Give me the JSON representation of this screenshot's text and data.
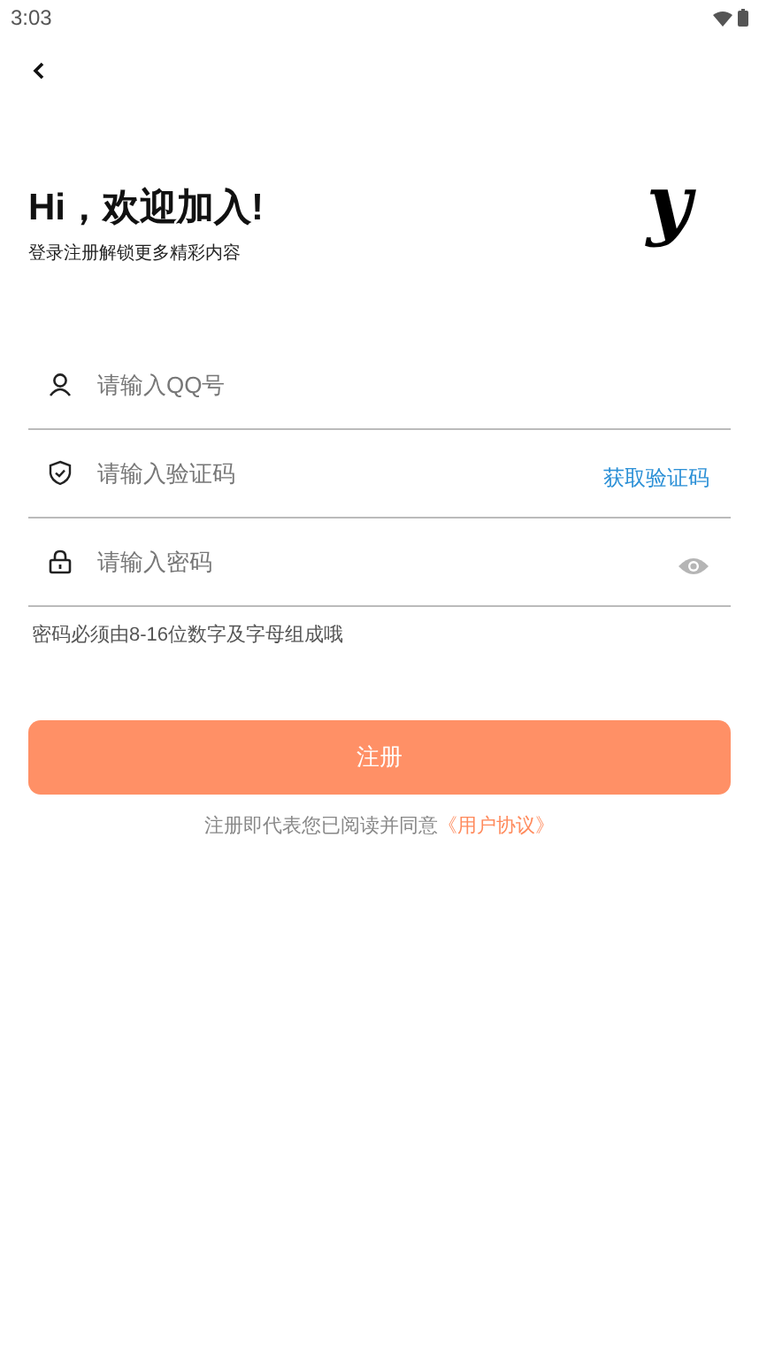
{
  "status_bar": {
    "time": "3:03"
  },
  "header": {
    "title": "Hi，欢迎加入!",
    "subtitle": "登录注册解锁更多精彩内容",
    "logo": "y"
  },
  "fields": [
    {
      "kind": "account",
      "placeholder": "请输入QQ号"
    },
    {
      "kind": "code",
      "placeholder": "请输入验证码",
      "action": "获取验证码"
    },
    {
      "kind": "password",
      "placeholder": "请输入密码"
    }
  ],
  "hint": "密码必须由8-16位数字及字母组成哦",
  "submit_button": "注册",
  "agreement": {
    "text": "注册即代表您已阅读并同意",
    "link": "《用户协议》"
  }
}
